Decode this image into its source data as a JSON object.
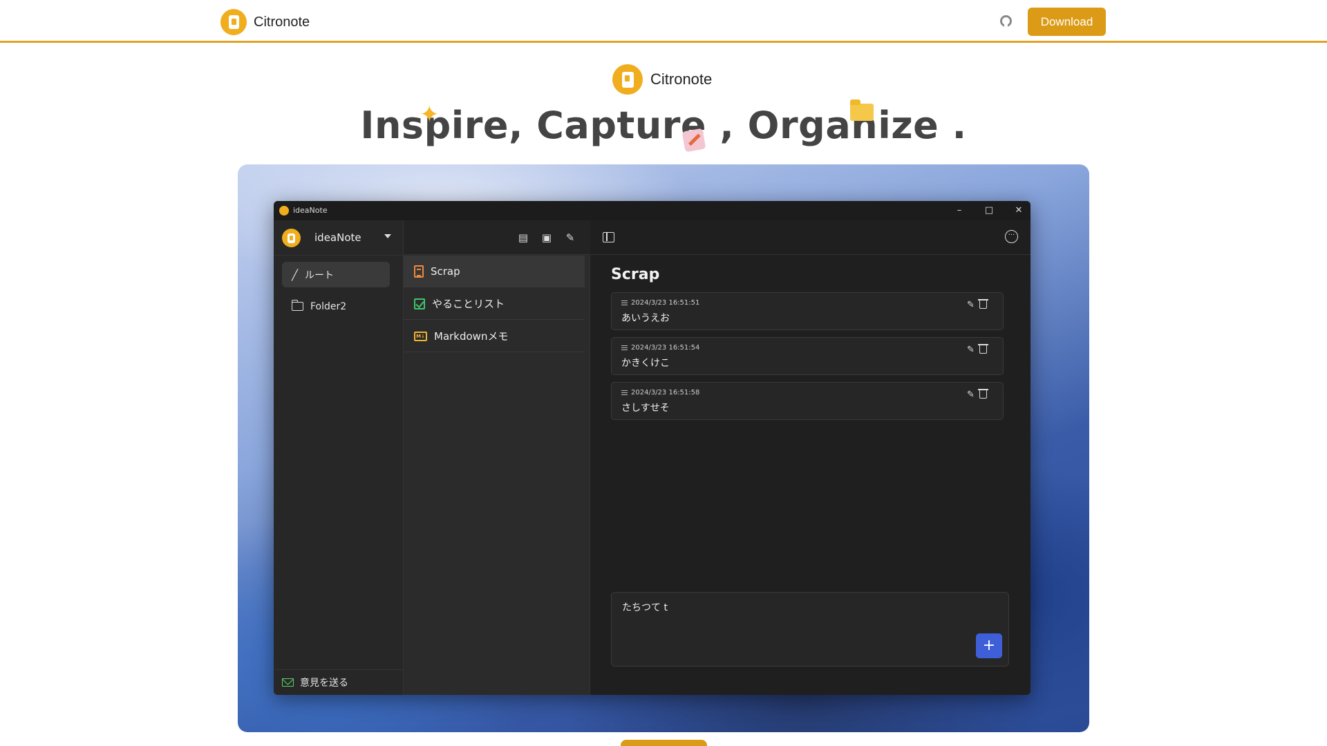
{
  "nav": {
    "brand": "Citronote",
    "download_label": "Download"
  },
  "hero": {
    "brand": "Citronote",
    "tagline": "Inspire, Capture , Organize ."
  },
  "app": {
    "window_title": "ideaNote",
    "sidebar": {
      "workspace": "ideaNote",
      "items": [
        {
          "label": "ルート"
        },
        {
          "label": "Folder2"
        }
      ],
      "feedback_label": "意見を送る"
    },
    "notes": [
      {
        "label": "Scrap"
      },
      {
        "label": "やることリスト"
      },
      {
        "label": "Markdownメモ"
      }
    ],
    "main": {
      "title": "Scrap",
      "entries": [
        {
          "timestamp": "2024/3/23 16:51:51",
          "text": "あいうえお"
        },
        {
          "timestamp": "2024/3/23 16:51:54",
          "text": "かきくけこ"
        },
        {
          "timestamp": "2024/3/23 16:51:58",
          "text": "さしすせそ"
        }
      ],
      "composer_value": "たちつて t",
      "add_label": "+"
    }
  },
  "colors": {
    "accent": "#dc9b16",
    "add_button": "#3f5fd8"
  }
}
